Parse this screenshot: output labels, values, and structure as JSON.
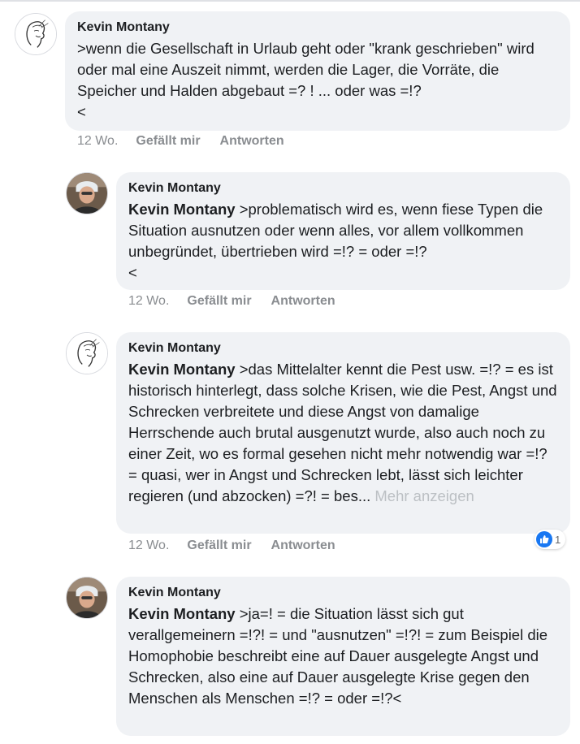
{
  "comments": [
    {
      "author": "Kevin Montany",
      "mention": "",
      "text": ">wenn die Gesellschaft in Urlaub geht oder \"krank geschrieben\" wird oder mal eine Auszeit nimmt, werden die  Lager, die Vorräte, die Speicher und Halden abgebaut =? ! ... oder was =!?\n<",
      "time": "12 Wo.",
      "like_label": "Gefällt mir",
      "reply_label": "Antworten",
      "avatar": "sketch-face-icon"
    },
    {
      "author": "Kevin Montany",
      "mention": "Kevin Montany",
      "text": " >problematisch wird es, wenn fiese Typen die Situation ausnutzen oder wenn alles, vor allem vollkommen unbegründet, übertrieben wird =!? = oder =!?\n<",
      "time": "12 Wo.",
      "like_label": "Gefällt mir",
      "reply_label": "Antworten",
      "avatar": "photo-avatar"
    },
    {
      "author": "Kevin Montany",
      "mention": "Kevin Montany",
      "text": " >das Mittelalter kennt die Pest usw. =!? = es ist historisch hinterlegt, dass solche Krisen, wie die Pest, Angst und Schrecken verbreitete und diese Angst von  damalige Herrschende auch brutal ausgenutzt wurde, also auch noch zu einer Zeit, wo es formal gesehen nicht mehr notwendig war =!? = quasi, wer in Angst und Schrecken lebt, lässt sich leichter regieren (und abzocken) =?! = bes...",
      "more_label": " Mehr anzeigen",
      "time": "12 Wo.",
      "like_label": "Gefällt mir",
      "reply_label": "Antworten",
      "reaction_count": "1",
      "avatar": "sketch-face-icon"
    },
    {
      "author": "Kevin Montany",
      "mention": "Kevin Montany",
      "text": " >ja=! = die Situation lässt sich gut verallgemeinern =!?! = und \"ausnutzen\" =!?! = zum Beispiel die Homophobie beschreibt eine auf Dauer ausgelegte Angst und Schrecken, also eine auf Dauer ausgelegte Krise gegen den Menschen als Menschen =!? = oder =!?<",
      "avatar": "photo-avatar"
    }
  ],
  "colors": {
    "bubble": "#f0f2f5",
    "meta": "#8a8d91",
    "like_blue": "#1877f2"
  }
}
